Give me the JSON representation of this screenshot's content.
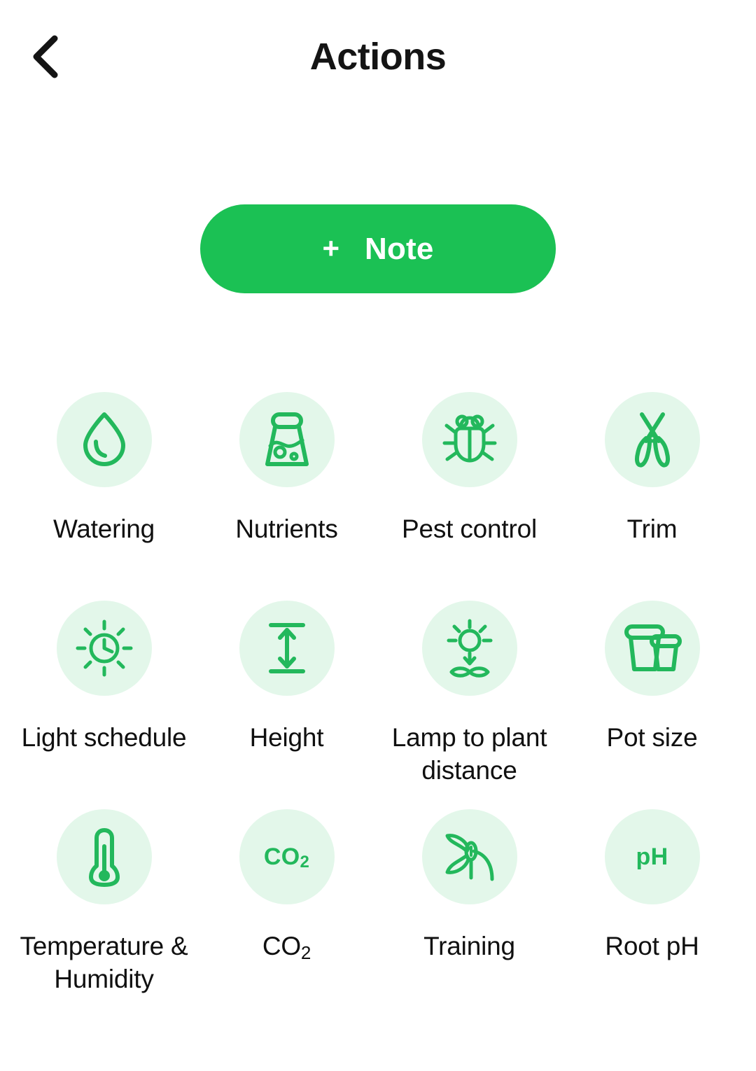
{
  "header": {
    "back_icon": "chevron-left-icon",
    "title": "Actions"
  },
  "note_button": {
    "plus": "+",
    "label": "Note"
  },
  "colors": {
    "accent_green": "#1BC154",
    "icon_green": "#23B85C",
    "icon_circle_bg": "#E3F7EA",
    "title_text": "#141414",
    "label_text": "#101010",
    "page_bg": "#FFFFFF"
  },
  "actions": {
    "rows": [
      [
        {
          "id": "watering",
          "label": "Watering",
          "icon": "water-drop-icon"
        },
        {
          "id": "nutrients",
          "label": "Nutrients",
          "icon": "fertilizer-bag-icon"
        },
        {
          "id": "pest-control",
          "label": "Pest control",
          "icon": "bug-icon"
        },
        {
          "id": "trim",
          "label": "Trim",
          "icon": "pruning-shears-icon"
        }
      ],
      [
        {
          "id": "light-schedule",
          "label": "Light schedule",
          "icon": "sun-clock-icon"
        },
        {
          "id": "height",
          "label": "Height",
          "icon": "vertical-measure-icon"
        },
        {
          "id": "lamp-to-plant-distance",
          "label": "Lamp to plant distance",
          "icon": "sun-to-plant-icon"
        },
        {
          "id": "pot-size",
          "label": "Pot size",
          "icon": "pots-icon"
        }
      ],
      [
        {
          "id": "temperature-humidity",
          "label": "Temperature & Humidity",
          "icon": "thermometer-icon"
        },
        {
          "id": "co2",
          "label": "CO₂",
          "label_main": "CO",
          "label_sub": "2",
          "icon": "co2-text-icon",
          "icon_main": "CO",
          "icon_sub": "2"
        },
        {
          "id": "training",
          "label": "Training",
          "icon": "plant-training-icon"
        },
        {
          "id": "root-ph",
          "label": "Root pH",
          "icon": "ph-text-icon",
          "icon_main": "pH"
        }
      ]
    ]
  }
}
